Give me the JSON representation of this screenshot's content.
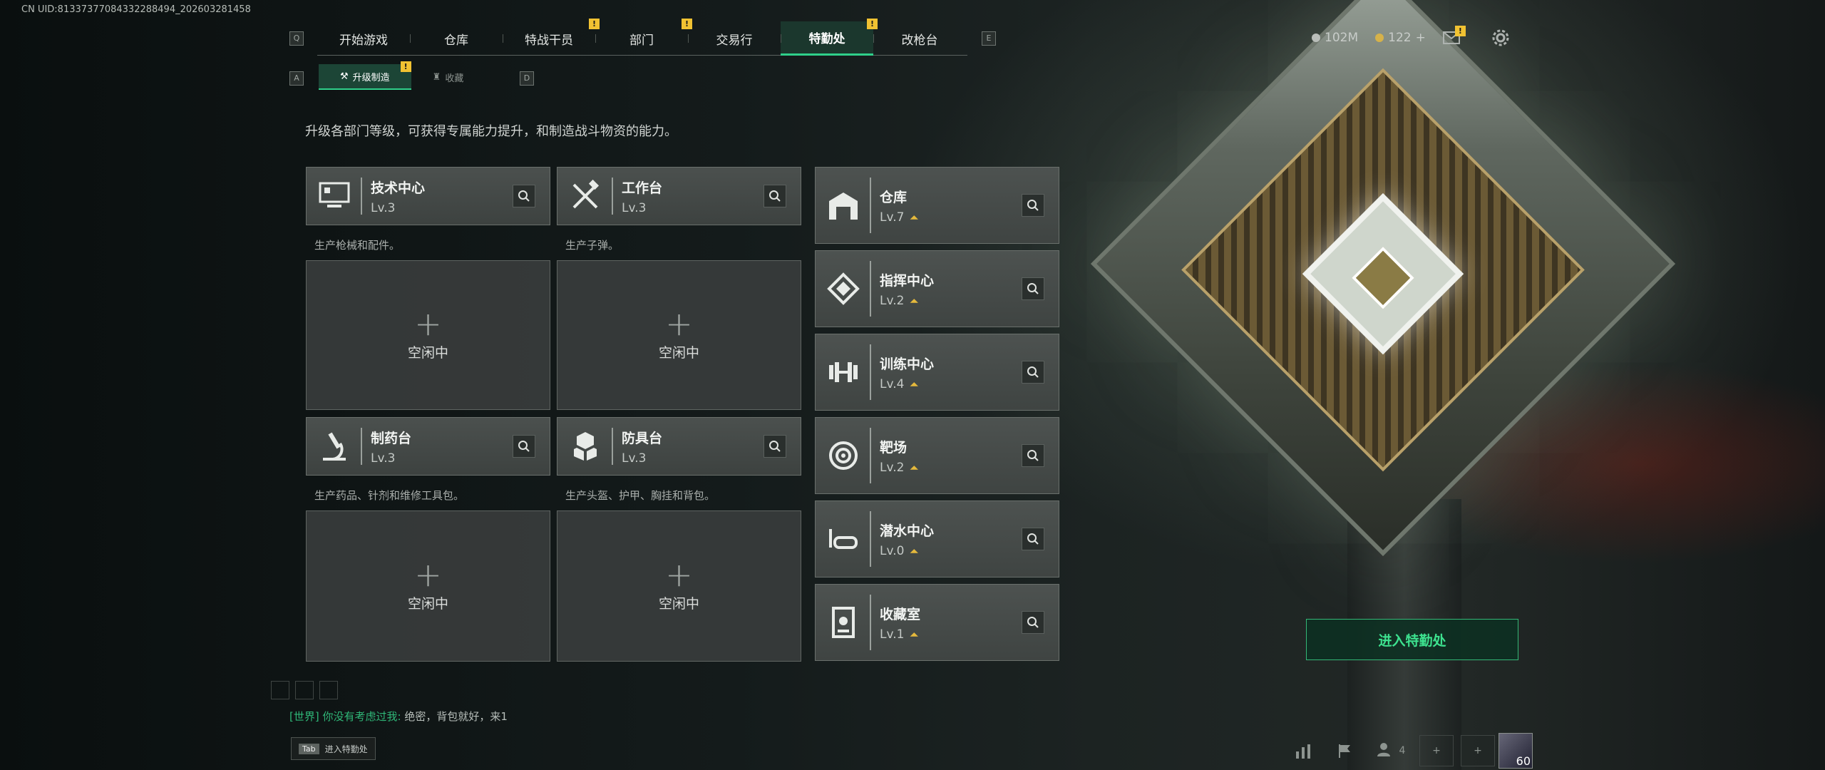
{
  "uid_text": "CN UID:81337377084332288494_202603281458",
  "keys": {
    "prev_tab": "Q",
    "next_tab": "E",
    "prev_sub": "A",
    "next_sub": "D"
  },
  "topnav": {
    "tabs": [
      {
        "label": "开始游戏",
        "badge": ""
      },
      {
        "label": "仓库",
        "badge": ""
      },
      {
        "label": "特战干员",
        "badge": "!"
      },
      {
        "label": "部门",
        "badge": "!"
      },
      {
        "label": "交易行",
        "badge": ""
      },
      {
        "label": "特勤处",
        "badge": "!"
      },
      {
        "label": "改枪台",
        "badge": ""
      }
    ],
    "active_index": 5
  },
  "subnav": {
    "tabs": [
      {
        "label": "升级制造",
        "badge": "!",
        "icon": "wrench-icon"
      },
      {
        "label": "收藏",
        "badge": "",
        "icon": "trophy-icon"
      }
    ]
  },
  "description": "升级各部门等级，可获得专属能力提升，和制造战斗物资的能力。",
  "crafting": [
    {
      "name": "技术中心",
      "level": "Lv.3",
      "sub": "生产枪械和配件。",
      "slot": "空闲中",
      "icon": "computer-icon"
    },
    {
      "name": "工作台",
      "level": "Lv.3",
      "sub": "生产子弹。",
      "slot": "空闲中",
      "icon": "tools-icon"
    },
    {
      "name": "制药台",
      "level": "Lv.3",
      "sub": "生产药品、针剂和维修工具包。",
      "slot": "空闲中",
      "icon": "microscope-icon"
    },
    {
      "name": "防具台",
      "level": "Lv.3",
      "sub": "生产头盔、护甲、胸挂和背包。",
      "slot": "空闲中",
      "icon": "armor-icon"
    }
  ],
  "departments": [
    {
      "name": "仓库",
      "level": "Lv.7",
      "icon": "warehouse-icon",
      "upgradable": true
    },
    {
      "name": "指挥中心",
      "level": "Lv.2",
      "icon": "command-icon",
      "upgradable": true
    },
    {
      "name": "训练中心",
      "level": "Lv.4",
      "icon": "dumbbell-icon",
      "upgradable": true
    },
    {
      "name": "靶场",
      "level": "Lv.2",
      "icon": "target-icon",
      "upgradable": true
    },
    {
      "name": "潜水中心",
      "level": "Lv.0",
      "icon": "diving-icon",
      "upgradable": true
    },
    {
      "name": "收藏室",
      "level": "Lv.1",
      "icon": "collection-icon",
      "upgradable": true
    }
  ],
  "resources": {
    "silver": "102M",
    "gold": "122",
    "gold_suffix": "+"
  },
  "enter_button": "进入特勤处",
  "chat": {
    "channel": "[世界]",
    "speaker": "你没有考虑过我:",
    "message": "绝密，背包就好，来1"
  },
  "tab_hint": {
    "key": "Tab",
    "label": "进入特勤处"
  },
  "party": {
    "count": "4"
  },
  "avatar": {
    "level": "60"
  },
  "colors": {
    "accent": "#2fd08a",
    "badge": "#f1c232",
    "upgrade": "#e5b93c"
  }
}
